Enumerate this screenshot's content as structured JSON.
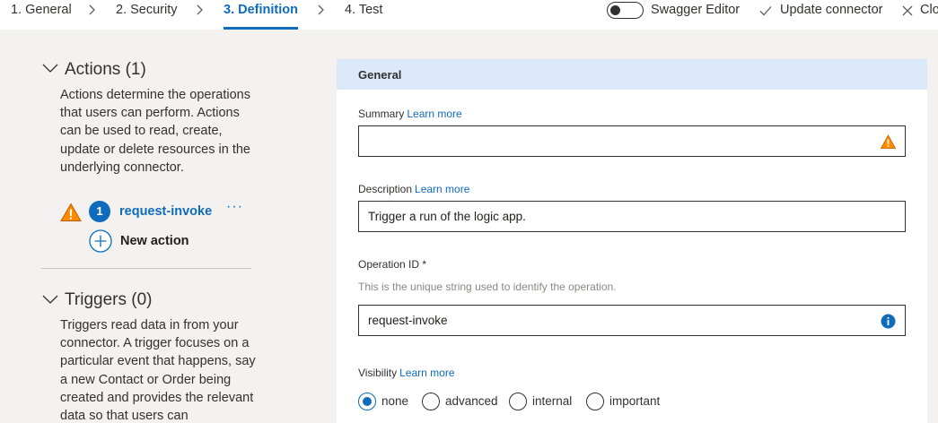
{
  "nav": {
    "steps": [
      {
        "label": "1. General"
      },
      {
        "label": "2. Security"
      },
      {
        "label": "3. Definition"
      },
      {
        "label": "4. Test"
      }
    ],
    "swagger_label": "Swagger Editor",
    "update_label": "Update connector",
    "close_label": "Clo"
  },
  "sidebar": {
    "actions": {
      "heading": "Actions (1)",
      "description": "Actions determine the operations that users can perform. Actions can be used to read, create, update or delete resources in the underlying connector.",
      "items": [
        {
          "number": "1",
          "name": "request-invoke",
          "more": "···"
        }
      ],
      "new_label": "New action"
    },
    "triggers": {
      "heading": "Triggers (0)",
      "description": "Triggers read data in from your connector. A trigger focuses on a particular event that happens, say a new Contact or Order being created and provides the relevant data so that users can"
    }
  },
  "general": {
    "title": "General",
    "summary": {
      "label": "Summary",
      "learn": "Learn more",
      "value": ""
    },
    "description": {
      "label": "Description",
      "learn": "Learn more",
      "value": "Trigger a run of the logic app."
    },
    "operation_id": {
      "label": "Operation ID *",
      "hint": "This is the unique string used to identify the operation.",
      "value": "request-invoke"
    },
    "visibility": {
      "label": "Visibility",
      "learn": "Learn more",
      "options": [
        {
          "label": "none",
          "checked": true
        },
        {
          "label": "advanced",
          "checked": false
        },
        {
          "label": "internal",
          "checked": false
        },
        {
          "label": "important",
          "checked": false
        }
      ]
    }
  },
  "colors": {
    "accent": "#0f6cbd",
    "warning": "#ff8c00",
    "header_bg": "#dbe9fb",
    "page_bg": "#f3f2f1"
  }
}
